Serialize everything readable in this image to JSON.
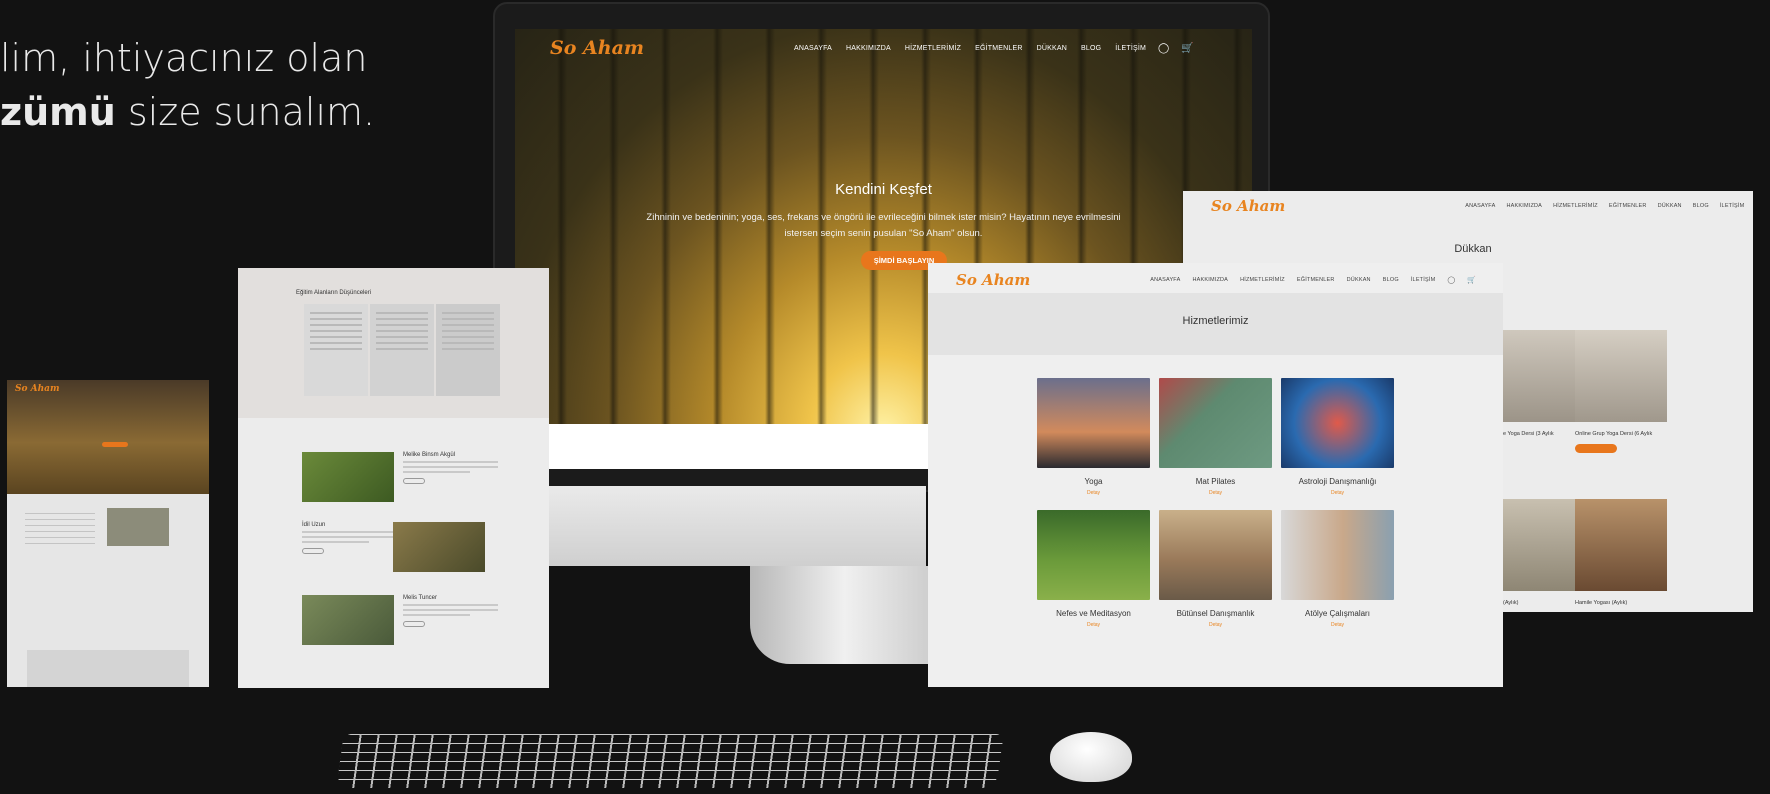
{
  "headline": {
    "line1": "lim, ihtiyacınız olan",
    "line2_bold": "zümü",
    "line2_rest": " size sunalım."
  },
  "brand": {
    "logo": "So Aham",
    "accent": "#e8761c"
  },
  "menu": [
    "ANASAYFA",
    "HAKKIMIZDA",
    "HİZMETLERİMİZ",
    "EĞİTMENLER",
    "DÜKKAN",
    "BLOG",
    "İLETİŞİM"
  ],
  "hero": {
    "title": "Kendini Keşfet",
    "text": "Zihninin ve bedeninin; yoga, ses, frekans ve öngörü ile evrileceğini bilmek ister misin? Hayatının neye evrilmesini istersen seçim senin pusulan \"So Aham\" olsun.",
    "button": "ŞİMDİ BAŞLAYIN"
  },
  "services": {
    "title": "Hizmetlerimiz",
    "items": [
      {
        "name": "Yoga",
        "more": "Detay"
      },
      {
        "name": "Mat Pilates",
        "more": "Detay"
      },
      {
        "name": "Astroloji Danışmanlığı",
        "more": "Detay"
      },
      {
        "name": "Nefes ve Meditasyon",
        "more": "Detay"
      },
      {
        "name": "Bütünsel Danışmanlık",
        "more": "Detay"
      },
      {
        "name": "Atölye Çalışmaları",
        "more": "Detay"
      }
    ]
  },
  "shop": {
    "title": "Dükkan",
    "products": [
      {
        "text": "e Yoga Dersi (3 Aylık"
      },
      {
        "text": "Online Grup Yoga Dersi (6 Aylık"
      },
      {
        "text": "(Aylık)"
      },
      {
        "text": "Hamile Yogası (Aylık)"
      }
    ]
  },
  "testimonials": {
    "title": "Eğitim Alanların Düşünceleri",
    "trainers": [
      {
        "name": "Melike Binsm Akgül"
      },
      {
        "name": "İdil Uzun"
      },
      {
        "name": "Melis Tuncer"
      }
    ]
  }
}
